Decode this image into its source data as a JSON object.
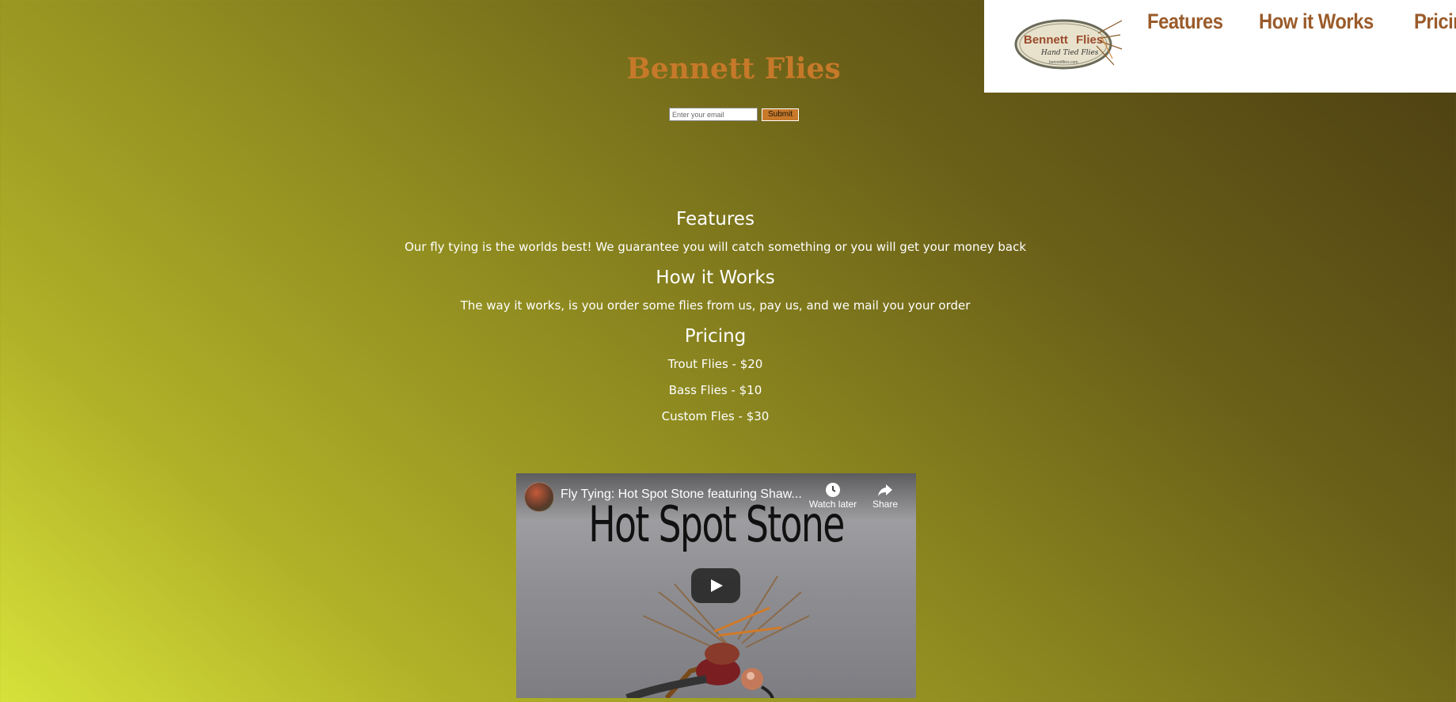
{
  "nav": {
    "logo": {
      "title": "Bennett",
      "title2": "Flies",
      "tagline": "Hand Tied Flies",
      "url": "bennettflies.com"
    },
    "links": [
      "Features",
      "How it Works",
      "Pricing"
    ]
  },
  "header": {
    "title": "Bennett Flies",
    "email_placeholder": "Enter your email",
    "submit_label": "Submit"
  },
  "sections": {
    "features": {
      "heading": "Features",
      "text": "Our fly tying is the worlds best! We guarantee you will catch something or you will get your money back"
    },
    "how": {
      "heading": "How it Works",
      "text": "The way it works, is you order some flies from us, pay us, and we mail you your order"
    },
    "pricing": {
      "heading": "Pricing",
      "items": [
        "Trout Flies - $20",
        "Bass Flies - $10",
        "Custom Fles - $30"
      ]
    }
  },
  "video": {
    "title": "Fly Tying: Hot Spot Stone featuring Shaw...",
    "thumbnail_text": "Hot Spot Stone",
    "watch_later_label": "Watch later",
    "share_label": "Share"
  },
  "colors": {
    "accent": "#c7792a",
    "nav_link": "#9a5b2a",
    "text": "#ffffff"
  }
}
